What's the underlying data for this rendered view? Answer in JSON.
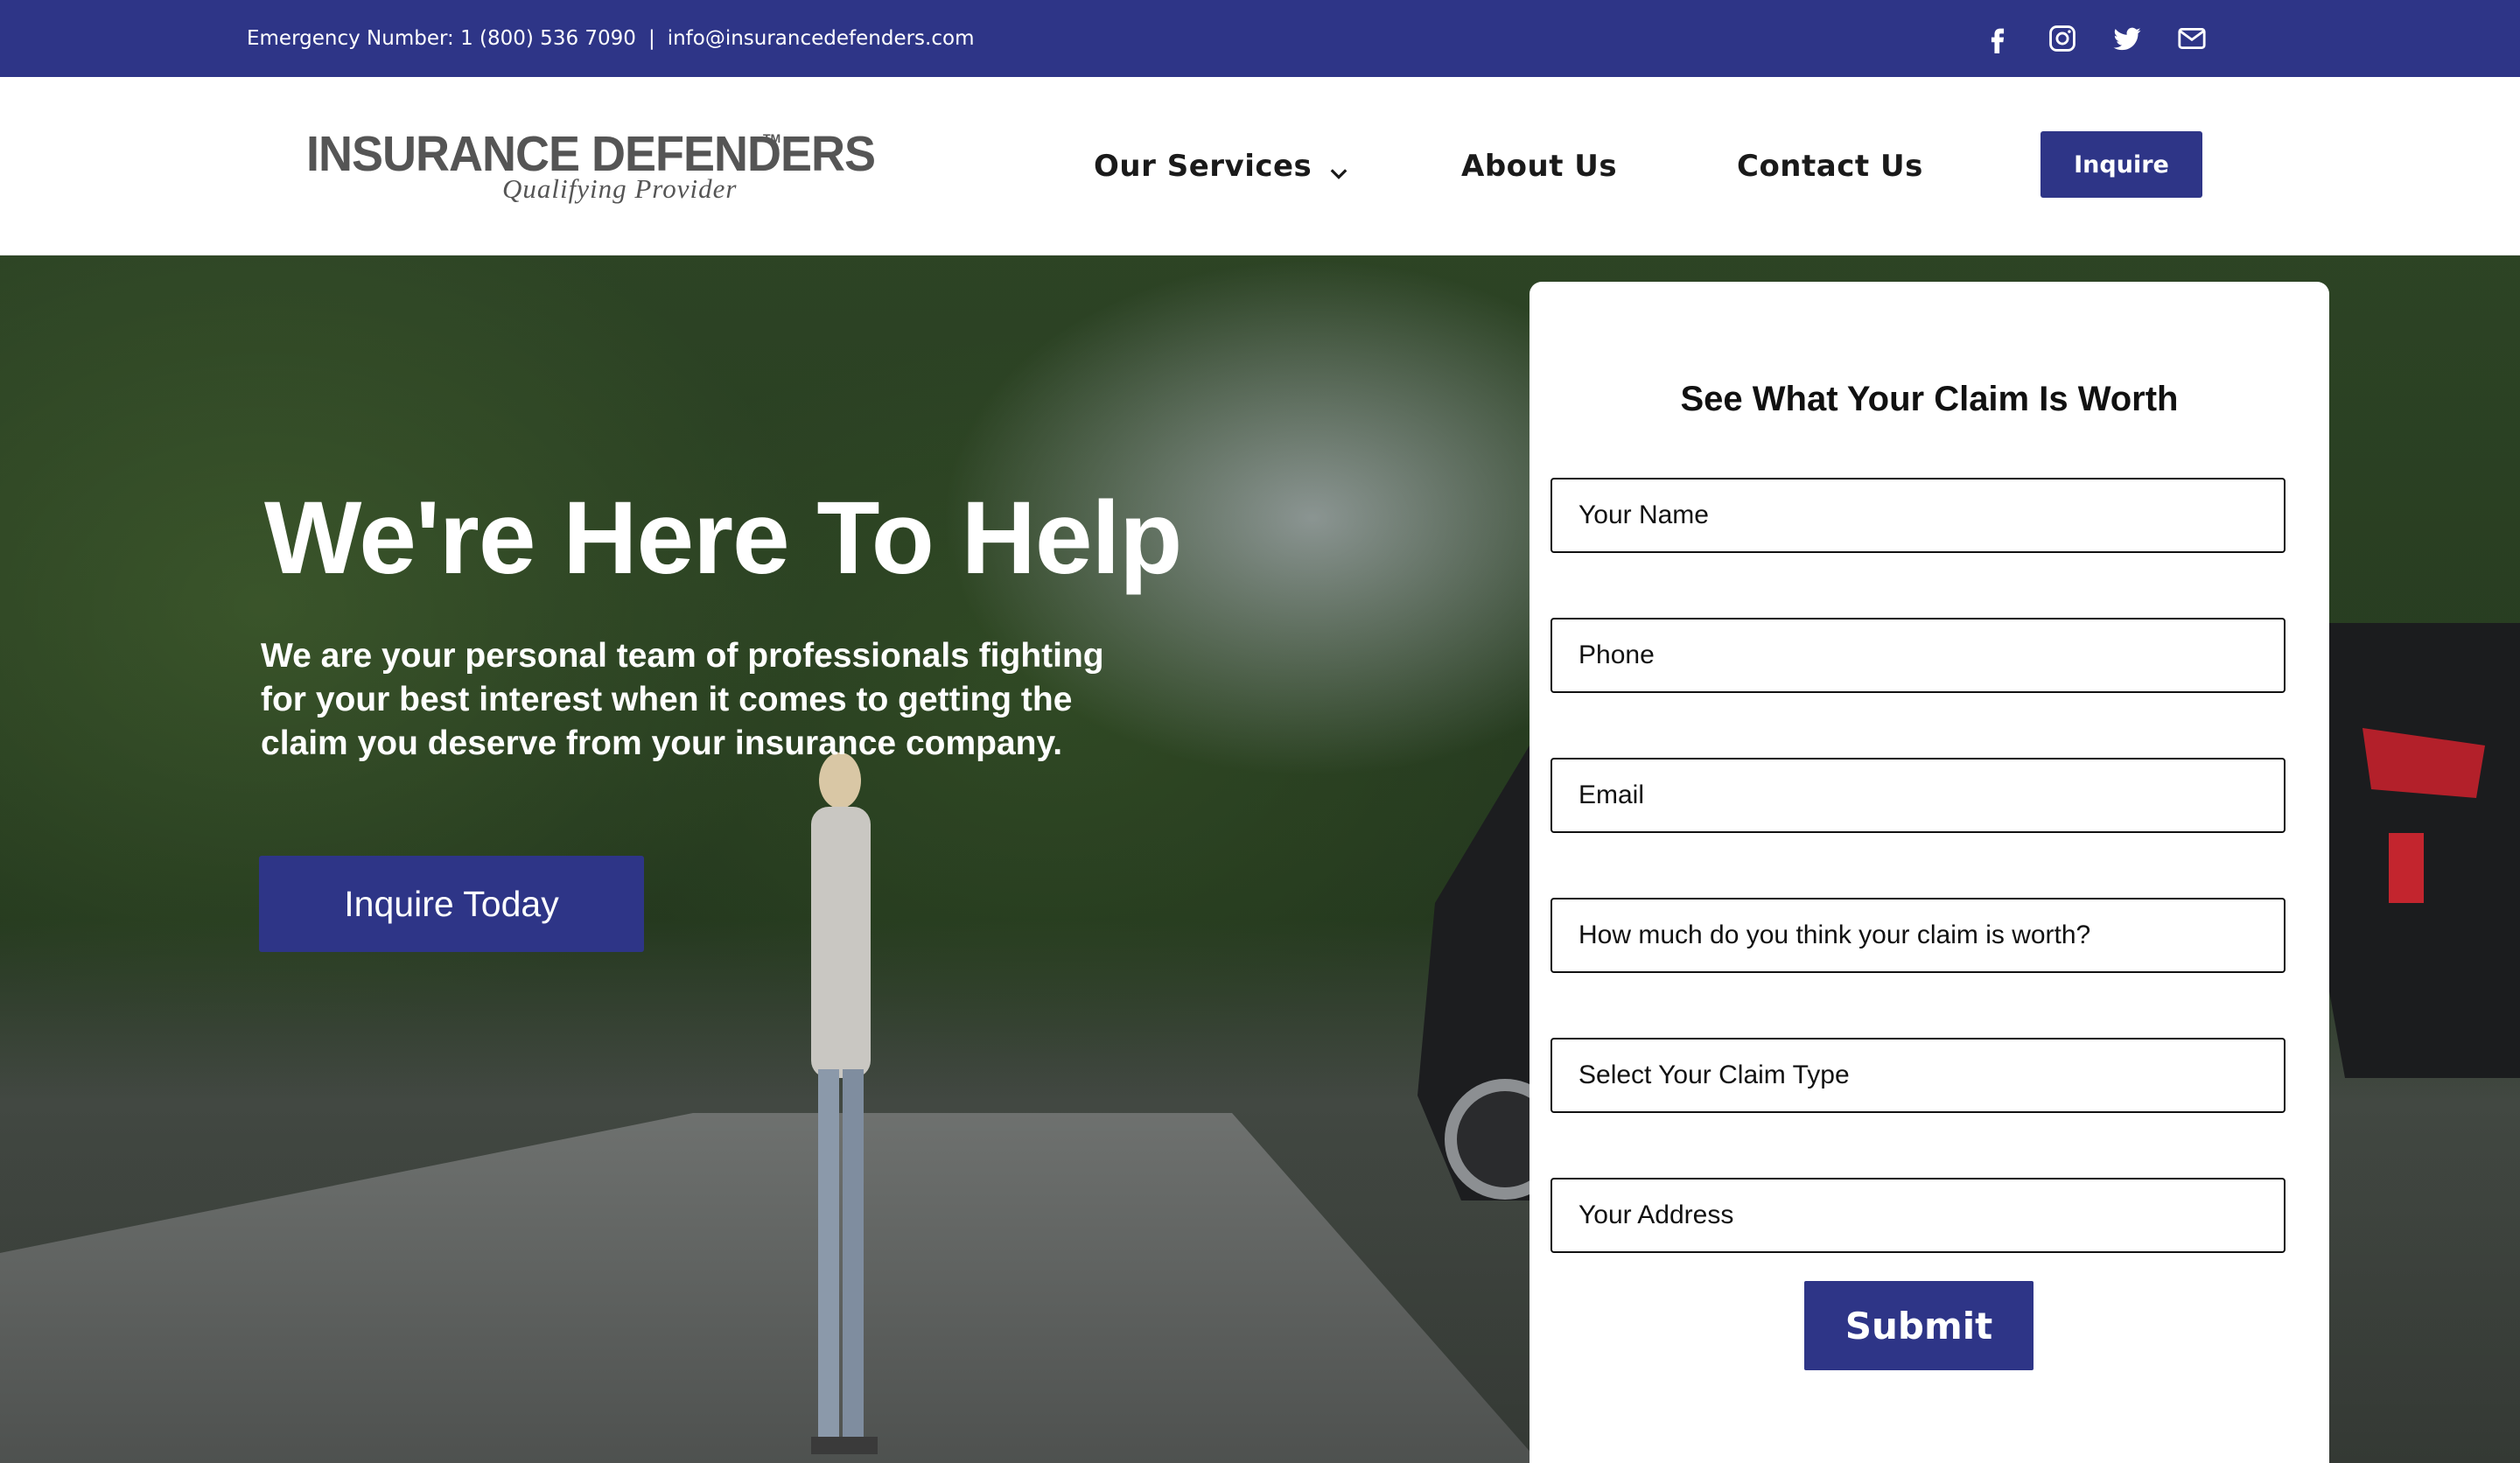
{
  "topbar": {
    "emergency": "Emergency Number: 1 (800) 536 7090",
    "separator": "|",
    "email": "info@insurancedefenders.com",
    "socials": [
      "facebook-icon",
      "instagram-icon",
      "twitter-icon",
      "mail-icon"
    ]
  },
  "header": {
    "logo_main": "INSURANCE DEFENDERS",
    "logo_tm": "TM",
    "logo_sub": "Qualifying Provider",
    "nav": {
      "services": "Our Services",
      "about": "About Us",
      "contact": "Contact Us"
    },
    "inquire": "Inquire"
  },
  "hero": {
    "title": "We're Here To Help",
    "text": "We are your personal team of professionals fighting for your best interest when it comes to getting the claim you deserve from your insurance company.",
    "button": "Inquire Today"
  },
  "form": {
    "title": "See What Your Claim Is Worth",
    "fields": {
      "name": "Your Name",
      "phone": "Phone",
      "email": "Email",
      "worth": "How much do you think your claim is worth?",
      "claim_type": "Select Your Claim Type",
      "address": "Your Address"
    },
    "submit": "Submit"
  },
  "colors": {
    "brand": "#2e3587",
    "white": "#ffffff",
    "text": "#111111"
  }
}
